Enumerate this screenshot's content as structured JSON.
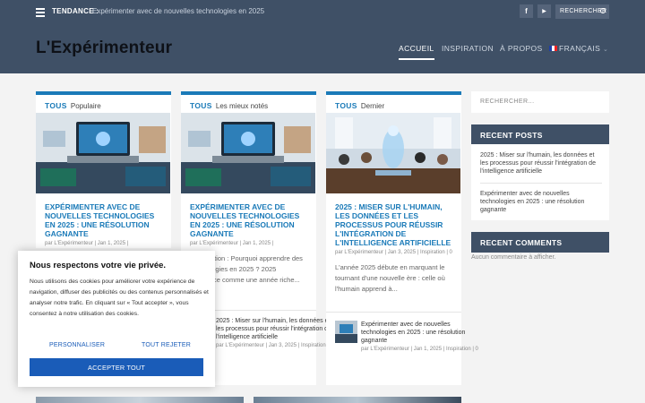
{
  "topbar": {
    "trending_label": "TENDANCE :",
    "trending_text": "Expérimenter avec de nouvelles technologies en 2025 : u...",
    "facebook": "f",
    "youtube": "▶",
    "search_placeholder": "RECHERCHER"
  },
  "header": {
    "logo": "L'Expérimenteur",
    "nav": [
      "ACCUEIL",
      "INSPIRATION",
      "À PROPOS",
      "FRANÇAIS"
    ],
    "active": "ACCUEIL"
  },
  "cards": [
    {
      "tab_bold": "TOUS",
      "tab_label": "Populaire",
      "title": "Expérimenter avec de nouvelles technologies en 2025 : une résolution gagnante",
      "meta": "par L'Expérimenteur | Jan 1, 2025 |"
    },
    {
      "tab_bold": "TOUS",
      "tab_label": "Les mieux notés",
      "title": "Expérimenter avec de nouvelles technologies en 2025 : une résolution gagnante",
      "meta": "par L'Expérimenteur | Jan 1, 2025 |",
      "excerpt": "Introduction : Pourquoi apprendre des technologies en 2025 ? 2025 s'annonce comme une année riche...",
      "mini_title": "2025 : Miser sur l'humain, les données et les processus pour réussir l'intégration de l'intelligence artificielle",
      "mini_meta": "par L'Expérimenteur | Jan 3, 2025 | Inspiration | 0"
    },
    {
      "tab_bold": "TOUS",
      "tab_label": "Dernier",
      "title": "2025 : Miser sur l'humain, les données et les processus pour réussir l'intégration de l'intelligence artificielle",
      "meta": "par L'Expérimenteur | Jan 3, 2025 | Inspiration | 0",
      "excerpt": "L'année 2025 débute en marquant le tournant d'une nouvelle ère : celle où l'humain apprend à...",
      "mini_title": "Expérimenter avec de nouvelles technologies en 2025 : une résolution gagnante",
      "mini_meta": "par L'Expérimenteur | Jan 1, 2025 | Inspiration | 0"
    }
  ],
  "sidebar": {
    "search_placeholder": "RECHERCHER...",
    "recent_posts_title": "RECENT POSTS",
    "recent_posts": [
      "2025 : Miser sur l'humain, les données et les processus pour réussir l'intégration de l'intelligence artificielle",
      "Expérimenter avec de nouvelles technologies en 2025 : une résolution gagnante"
    ],
    "recent_comments_title": "RECENT COMMENTS",
    "no_comments": "Aucun commentaire à afficher."
  },
  "cookie": {
    "title": "Nous respectons votre vie privée.",
    "text": "Nous utilisons des cookies pour améliorer votre expérience de navigation, diffuser des publicités ou des contenus personnalisés et analyser notre trafic. En cliquant sur « Tout accepter », vous consentez à notre utilisation des cookies.",
    "customize": "PERSONNALISER",
    "reject": "TOUT REJETER",
    "accept": "ACCEPTER TOUT"
  },
  "colors": {
    "header_bg": "#3f5066",
    "accent": "#1a7ab8",
    "cookie_accent": "#1a5cb8"
  }
}
